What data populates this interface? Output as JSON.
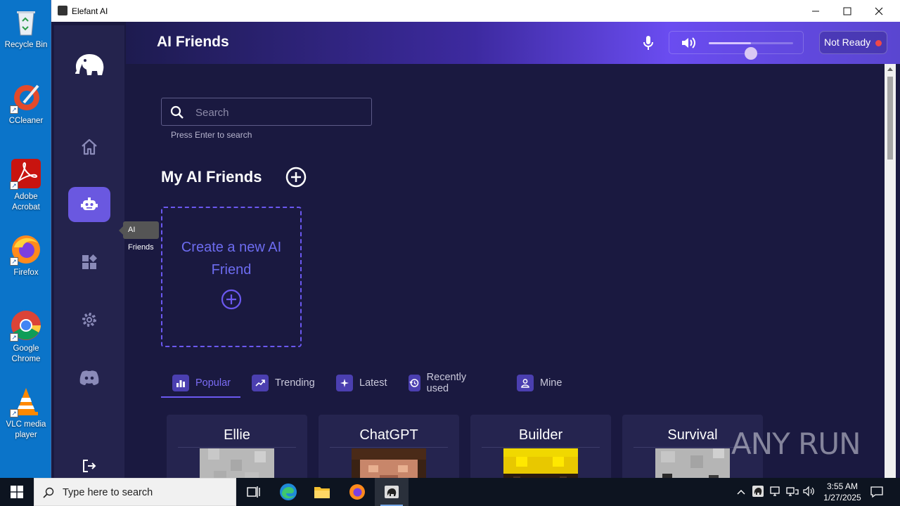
{
  "desktop": {
    "icons": [
      {
        "name": "recycle-bin",
        "label": "Recycle Bin"
      },
      {
        "name": "ccleaner",
        "label": "CCleaner"
      },
      {
        "name": "adobe-acrobat",
        "label": "Adobe Acrobat"
      },
      {
        "name": "firefox",
        "label": "Firefox"
      },
      {
        "name": "google-chrome",
        "label": "Google Chrome"
      },
      {
        "name": "vlc",
        "label": "VLC media player"
      }
    ]
  },
  "window": {
    "title": "Elefant AI",
    "controls": {
      "minimize": "—",
      "maximize": "☐",
      "close": "✕"
    }
  },
  "sidebar": {
    "items": [
      {
        "name": "logo",
        "icon": "elephant-icon"
      },
      {
        "name": "home",
        "icon": "home-icon"
      },
      {
        "name": "ai-friends",
        "icon": "robot-icon",
        "active": true,
        "tooltip": "AI Friends"
      },
      {
        "name": "apps",
        "icon": "widgets-icon"
      },
      {
        "name": "settings",
        "icon": "gear-icon"
      },
      {
        "name": "discord",
        "icon": "discord-icon"
      },
      {
        "name": "logout",
        "icon": "logout-icon"
      }
    ],
    "tooltip": "AI Friends"
  },
  "header": {
    "title": "AI Friends",
    "volume_level": 0.5,
    "status_label": "Not Ready",
    "status_color": "#f04848"
  },
  "search": {
    "placeholder": "Search",
    "value": "",
    "hint": "Press Enter to search"
  },
  "my_friends": {
    "title": "My AI Friends",
    "create_card_label": "Create a new AI Friend"
  },
  "tabs": [
    {
      "label": "Popular",
      "icon": "bar-chart-icon",
      "active": true
    },
    {
      "label": "Trending",
      "icon": "trending-icon",
      "active": false
    },
    {
      "label": "Latest",
      "icon": "sparkle-icon",
      "active": false
    },
    {
      "label": "Recently used",
      "icon": "history-icon",
      "active": false
    },
    {
      "label": "Mine",
      "icon": "person-icon",
      "active": false
    }
  ],
  "friends": [
    {
      "name": "Ellie"
    },
    {
      "name": "ChatGPT"
    },
    {
      "name": "Builder"
    },
    {
      "name": "Survival"
    }
  ],
  "watermark": "ANY RUN",
  "taskbar": {
    "search_placeholder": "Type here to search",
    "time": "3:55 AM",
    "date": "1/27/2025"
  },
  "colors": {
    "accent": "#6a58e0",
    "background": "#1a1940",
    "sidebar": "#24234d"
  }
}
